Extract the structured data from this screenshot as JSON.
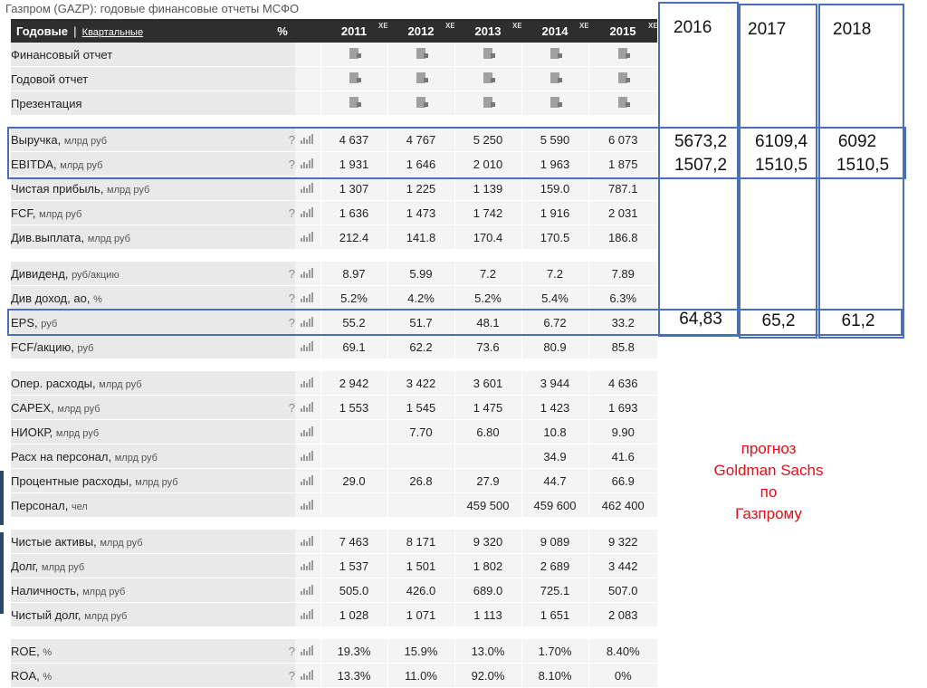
{
  "page_title": "Газпром (GAZP): годовые финансовые отчеты МСФО",
  "header": {
    "annual": "Годовые",
    "separator": "|",
    "quarterly": "Квартальные",
    "percent": "%",
    "years": [
      "2011",
      "2012",
      "2013",
      "2014",
      "2015"
    ],
    "xe_badge": "XE"
  },
  "doc_rows": [
    "Финансовый отчет",
    "Годовой отчет",
    "Презентация"
  ],
  "groups": [
    [
      {
        "label": "Выручка",
        "unit": "млрд руб",
        "q": "?",
        "values": [
          "4 637",
          "4 767",
          "5 250",
          "5 590",
          "6 073"
        ]
      },
      {
        "label": "EBITDA",
        "unit": "млрд руб",
        "q": "?",
        "values": [
          "1 931",
          "1 646",
          "2 010",
          "1 963",
          "1 875"
        ]
      },
      {
        "label": "Чистая прибыль",
        "unit": "млрд руб",
        "q": "",
        "values": [
          "1 307",
          "1 225",
          "1 139",
          "159.0",
          "787.1"
        ]
      },
      {
        "label": "FCF",
        "unit": "млрд руб",
        "q": "?",
        "values": [
          "1 636",
          "1 473",
          "1 742",
          "1 916",
          "2 031"
        ]
      },
      {
        "label": "Див.выплата",
        "unit": "млрд руб",
        "q": "",
        "values": [
          "212.4",
          "141.8",
          "170.4",
          "170.5",
          "186.8"
        ]
      }
    ],
    [
      {
        "label": "Дивиденд",
        "unit": "руб/акцию",
        "q": "?",
        "values": [
          "8.97",
          "5.99",
          "7.2",
          "7.2",
          "7.89"
        ]
      },
      {
        "label": "Див доход, ао",
        "unit": "%",
        "q": "?",
        "values": [
          "5.2%",
          "4.2%",
          "5.2%",
          "5.4%",
          "6.3%"
        ]
      },
      {
        "label": "EPS",
        "unit": "руб",
        "q": "?",
        "values": [
          "55.2",
          "51.7",
          "48.1",
          "6.72",
          "33.2"
        ]
      },
      {
        "label": "FCF/акцию",
        "unit": "руб",
        "q": "",
        "values": [
          "69.1",
          "62.2",
          "73.6",
          "80.9",
          "85.8"
        ]
      }
    ],
    [
      {
        "label": "Опер. расходы",
        "unit": "млрд руб",
        "q": "",
        "values": [
          "2 942",
          "3 422",
          "3 601",
          "3 944",
          "4 636"
        ]
      },
      {
        "label": "CAPEX",
        "unit": "млрд руб",
        "q": "?",
        "values": [
          "1 553",
          "1 545",
          "1 475",
          "1 423",
          "1 693"
        ]
      },
      {
        "label": "НИОКР",
        "unit": "млрд руб",
        "q": "",
        "values": [
          "",
          "7.70",
          "6.80",
          "10.8",
          "9.90"
        ]
      },
      {
        "label": "Расх на персонал",
        "unit": "млрд руб",
        "q": "",
        "values": [
          "",
          "",
          "",
          "34.9",
          "41.6"
        ]
      },
      {
        "label": "Процентные расходы",
        "unit": "млрд руб",
        "q": "",
        "values": [
          "29.0",
          "26.8",
          "27.9",
          "44.7",
          "66.9"
        ]
      },
      {
        "label": "Персонал",
        "unit": "чел",
        "q": "",
        "values": [
          "",
          "",
          "459 500",
          "459 600",
          "462 400"
        ]
      }
    ],
    [
      {
        "label": "Чистые активы",
        "unit": "млрд руб",
        "q": "",
        "values": [
          "7 463",
          "8 171",
          "9 320",
          "9 089",
          "9 322"
        ]
      },
      {
        "label": "Долг",
        "unit": "млрд руб",
        "q": "",
        "values": [
          "1 537",
          "1 501",
          "1 802",
          "2 689",
          "3 442"
        ]
      },
      {
        "label": "Наличность",
        "unit": "млрд руб",
        "q": "",
        "values": [
          "505.0",
          "426.0",
          "689.0",
          "725.1",
          "507.0"
        ]
      },
      {
        "label": "Чистый долг",
        "unit": "млрд руб",
        "q": "",
        "values": [
          "1 028",
          "1 071",
          "1 113",
          "1 651",
          "2 083"
        ]
      }
    ],
    [
      {
        "label": "ROE",
        "unit": "%",
        "q": "?",
        "values": [
          "19.3%",
          "15.9%",
          "13.0%",
          "1.70%",
          "8.40%"
        ]
      },
      {
        "label": "ROA",
        "unit": "%",
        "q": "?",
        "values": [
          "13.3%",
          "11.0%",
          "92.0%",
          "8.10%",
          "0%"
        ]
      }
    ]
  ],
  "annotation": {
    "forecast_years": [
      "2016",
      "2017",
      "2018"
    ],
    "revenue": [
      "5673,2",
      "6109,4",
      "6092"
    ],
    "ebitda": [
      "1507,2",
      "1510,5",
      "1510,5"
    ],
    "eps": [
      "64,83",
      "65,2",
      "61,2"
    ],
    "note_lines": [
      "прогноз",
      "Goldman Sachs",
      "по",
      "Газпрому"
    ],
    "outline_color": "#4a6fb8",
    "note_color": "#e0101a"
  }
}
